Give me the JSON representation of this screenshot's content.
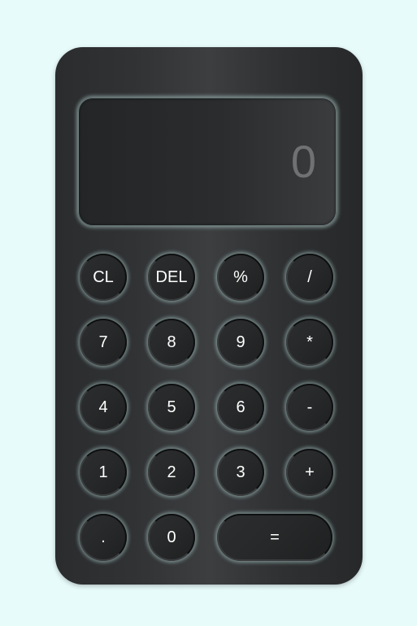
{
  "display": {
    "value": "0"
  },
  "keys": {
    "row1": [
      "CL",
      "DEL",
      "%",
      "/"
    ],
    "row2": [
      "7",
      "8",
      "9",
      "*"
    ],
    "row3": [
      "4",
      "5",
      "6",
      "-"
    ],
    "row4": [
      "1",
      "2",
      "3",
      "+"
    ],
    "row5": [
      ".",
      "0",
      "="
    ]
  },
  "colors": {
    "page_background": "#e8fbfb",
    "body": "#303234",
    "key_glow": "#b4d7d2",
    "key_text": "#ffffff",
    "display_text": "#6f7173"
  }
}
